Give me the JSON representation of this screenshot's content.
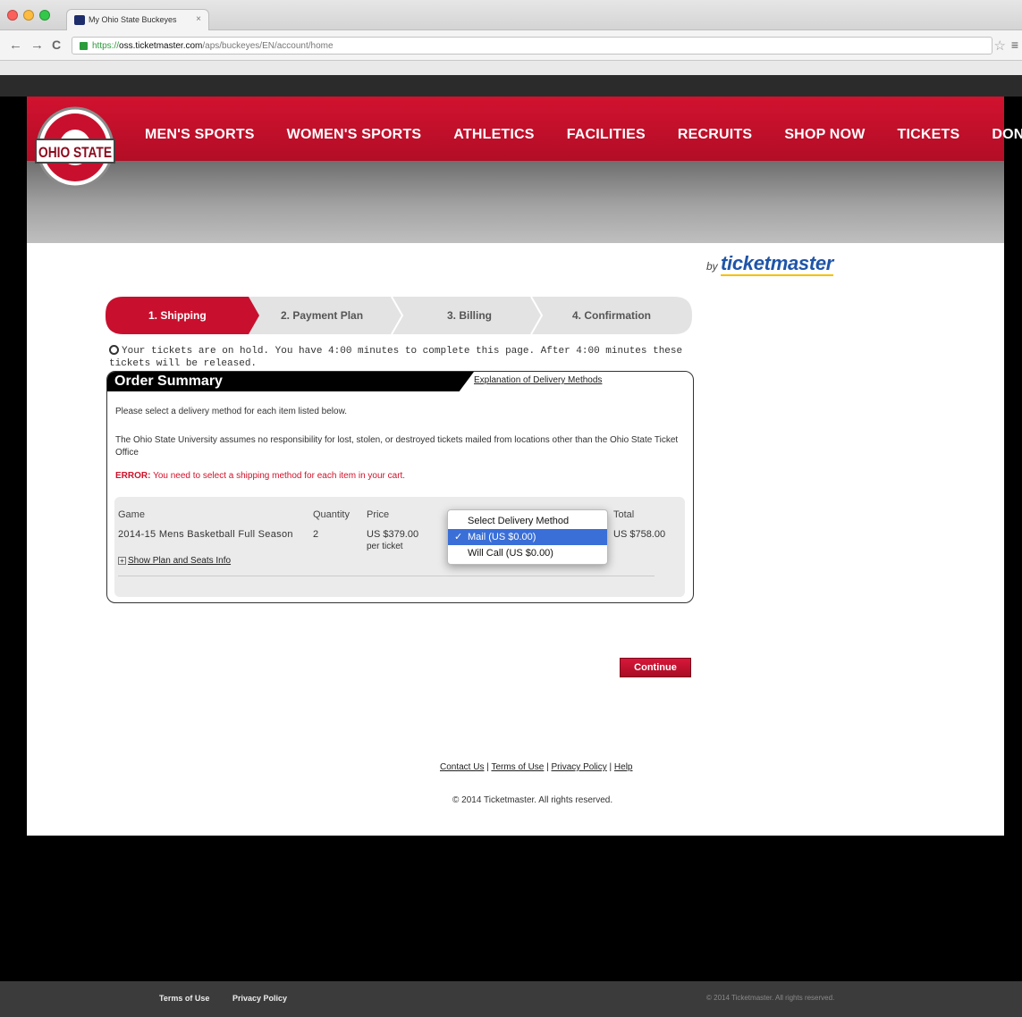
{
  "browser": {
    "tab_title": "My Ohio State Buckeyes",
    "url_scheme": "https://",
    "url_domain": "oss.ticketmaster.com",
    "url_path": "/aps/buckeyes/EN/account/home"
  },
  "site": {
    "logo_text": "OHIO STATE",
    "nav": [
      "MEN'S SPORTS",
      "WOMEN'S SPORTS",
      "ATHLETICS",
      "FACILITIES",
      "RECRUITS",
      "SHOP NOW",
      "TICKETS",
      "DONATE"
    ],
    "by_text": "by",
    "ticketmaster": "ticketmaster",
    "colors": {
      "scarlet": "#bb0000",
      "gray": "#666666",
      "tm_blue": "#1f55a8"
    }
  },
  "steps": [
    "1. Shipping",
    "2. Payment Plan",
    "3. Billing",
    "4. Confirmation"
  ],
  "hold_notice": "Your tickets are on hold. You have 4:00 minutes to complete this page. After 4:00 minutes these tickets will be released.",
  "order": {
    "title": "Order Summary",
    "explain_link": "Explanation of Delivery Methods",
    "instruction": "Please select a delivery method for each item listed below.",
    "disclaimer": "The Ohio State University assumes no responsibility for lost, stolen, or destroyed tickets mailed from locations other than the Ohio State Ticket Office",
    "error_label": "ERROR:",
    "error_text": "You need to select a shipping method for each item in your cart.",
    "headers": {
      "game": "Game",
      "quantity": "Quantity",
      "price": "Price",
      "total": "Total"
    },
    "item": {
      "game": "2014-15 Mens Basketball Full Season",
      "quantity": "2",
      "price": "US $379.00",
      "price_unit": "per ticket",
      "total": "US $758.00",
      "plan_link": "Show Plan and Seats Info"
    },
    "delivery": {
      "header": "Select Delivery Method",
      "options": [
        "Mail  (US $0.00)",
        "Will Call  (US $0.00)"
      ],
      "selected": "Mail  (US $0.00)"
    }
  },
  "continue_label": "Continue",
  "footer": {
    "links": [
      "Contact Us",
      "Terms of Use",
      "Privacy Policy",
      "Help"
    ],
    "copyright": "© 2014 Ticketmaster. All rights reserved."
  },
  "bottom_bar": {
    "links": [
      "Terms of Use",
      "Privacy Policy"
    ],
    "copyright": "© 2014 Ticketmaster. All rights reserved."
  }
}
